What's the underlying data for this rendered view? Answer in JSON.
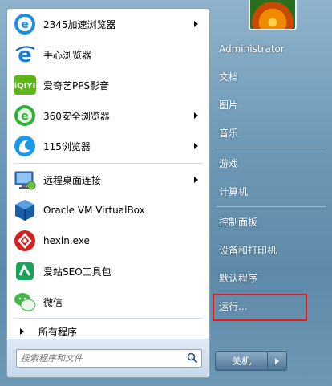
{
  "programs": [
    {
      "label": "2345加速浏览器",
      "icon": "ie-2345-icon",
      "has_submenu": true
    },
    {
      "label": "手心浏览器",
      "icon": "ie-shouxin-icon",
      "has_submenu": false
    },
    {
      "label": "爱奇艺PPS影音",
      "icon": "iqiyi-pps-icon",
      "has_submenu": false
    },
    {
      "label": "360安全浏览器",
      "icon": "360-browser-icon",
      "has_submenu": true
    },
    {
      "label": "115浏览器",
      "icon": "115-browser-icon",
      "has_submenu": true
    },
    {
      "label": "远程桌面连接",
      "icon": "remote-desktop-icon",
      "has_submenu": true
    },
    {
      "label": "Oracle VM VirtualBox",
      "icon": "virtualbox-icon",
      "has_submenu": false
    },
    {
      "label": "hexin.exe",
      "icon": "hexin-icon",
      "has_submenu": false
    },
    {
      "label": "爱站SEO工具包",
      "icon": "aizhan-seo-icon",
      "has_submenu": false
    },
    {
      "label": "微信",
      "icon": "wechat-icon",
      "has_submenu": false
    }
  ],
  "all_programs": "所有程序",
  "search": {
    "placeholder": "搜索程序和文件"
  },
  "right_links": {
    "user": "Administrator",
    "documents": "文档",
    "pictures": "图片",
    "music": "音乐",
    "games": "游戏",
    "computer": "计算机",
    "control_panel": "控制面板",
    "devices": "设备和打印机",
    "default_programs": "默认程序",
    "run": "运行..."
  },
  "shutdown": {
    "label": "关机"
  },
  "colors": {
    "highlight_border": "#e21b1b",
    "panel_blue": "#6f9bb8"
  }
}
